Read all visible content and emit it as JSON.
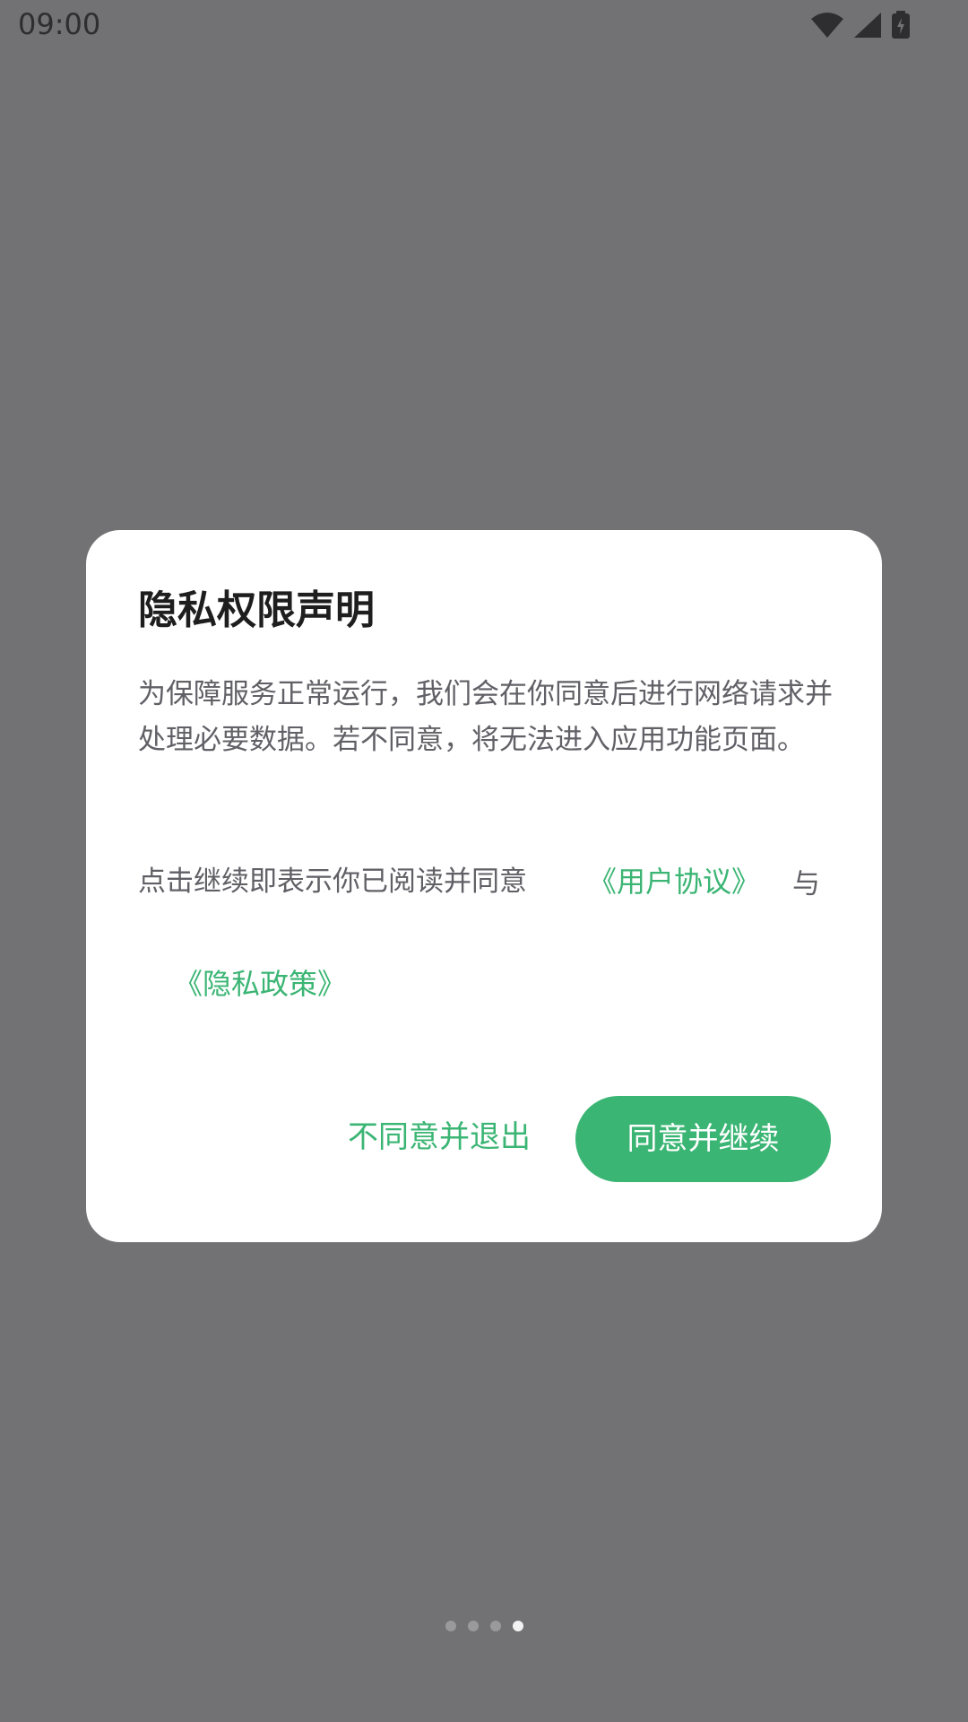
{
  "status_bar": {
    "time": "09:00",
    "icons": [
      "wifi-icon",
      "cell-signal-icon",
      "battery-charging-icon"
    ]
  },
  "dialog": {
    "title": "隐私权限声明",
    "message": "为保障服务正常运行，我们会在你同意后进行网络请求并处理必要数据。若不同意，将无法进入应用功能页面。",
    "agree_prefix": "点击继续即表示你已阅读并同意",
    "user_agreement_link": "《用户协议》",
    "and_text": "与",
    "privacy_policy_link": "《隐私政策》",
    "decline_button": "不同意并退出",
    "accept_button": "同意并继续"
  },
  "pager": {
    "total": 4,
    "active_index": 3
  },
  "colors": {
    "accent": "#3bb574",
    "overlay": "#727274",
    "dialog_bg": "#ffffff"
  }
}
